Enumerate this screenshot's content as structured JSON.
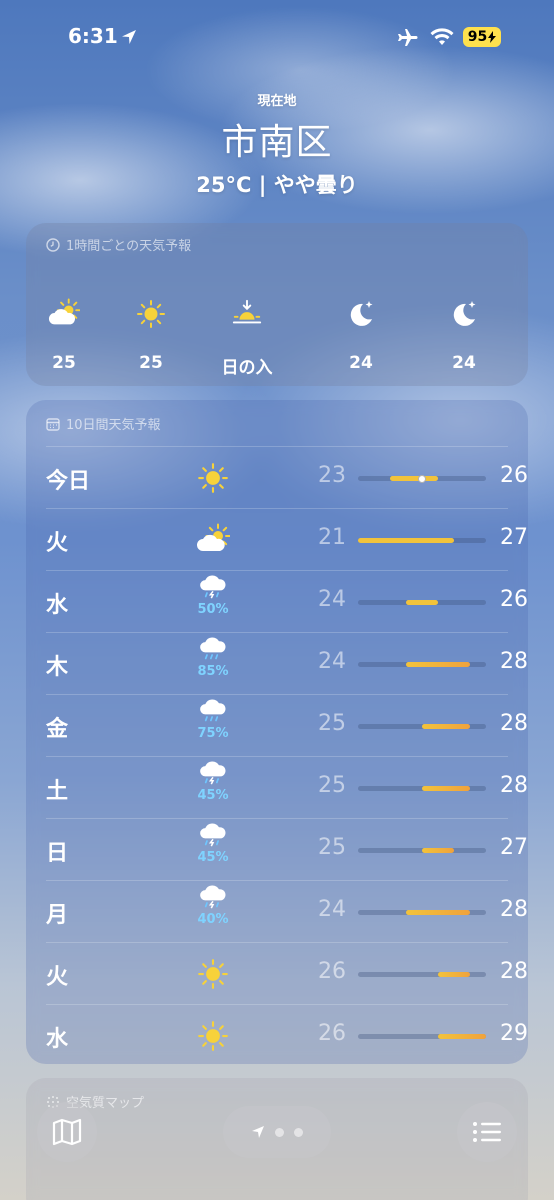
{
  "status": {
    "time": "6:31",
    "battery": "95"
  },
  "header": {
    "current_label": "現在地",
    "city": "市南区",
    "condition": "25°C | やや曇り"
  },
  "hourly": {
    "title": "1時間ごとの天気予報",
    "items": [
      {
        "icon": "partly-cloudy-sun-icon",
        "value": "25"
      },
      {
        "icon": "sun-icon",
        "value": "25"
      },
      {
        "icon": "sunset-icon",
        "value": "日の入"
      },
      {
        "icon": "moon-stars-icon",
        "value": "24"
      },
      {
        "icon": "moon-stars-icon",
        "value": "24"
      }
    ]
  },
  "ten_day": {
    "title": "10日間天気予報",
    "range": [
      21,
      29
    ],
    "current_temp": 25,
    "days": [
      {
        "day": "今日",
        "icon": "sun-icon",
        "pct": "",
        "low": "23",
        "high": "26",
        "lo_v": 23,
        "hi_v": 26
      },
      {
        "day": "火",
        "icon": "partly-cloudy-sun-icon",
        "pct": "",
        "low": "21",
        "high": "27",
        "lo_v": 21,
        "hi_v": 27
      },
      {
        "day": "水",
        "icon": "thunderstorm-rain-icon",
        "pct": "50%",
        "low": "24",
        "high": "26",
        "lo_v": 24,
        "hi_v": 26
      },
      {
        "day": "木",
        "icon": "rain-cloud-icon",
        "pct": "85%",
        "low": "24",
        "high": "28",
        "lo_v": 24,
        "hi_v": 28
      },
      {
        "day": "金",
        "icon": "rain-cloud-icon",
        "pct": "75%",
        "low": "25",
        "high": "28",
        "lo_v": 25,
        "hi_v": 28
      },
      {
        "day": "土",
        "icon": "thunderstorm-rain-icon",
        "pct": "45%",
        "low": "25",
        "high": "28",
        "lo_v": 25,
        "hi_v": 28
      },
      {
        "day": "日",
        "icon": "thunderstorm-rain-icon",
        "pct": "45%",
        "low": "25",
        "high": "27",
        "lo_v": 25,
        "hi_v": 27
      },
      {
        "day": "月",
        "icon": "thunderstorm-rain-icon",
        "pct": "40%",
        "low": "24",
        "high": "28",
        "lo_v": 24,
        "hi_v": 28
      },
      {
        "day": "火",
        "icon": "sun-icon",
        "pct": "",
        "low": "26",
        "high": "28",
        "lo_v": 26,
        "hi_v": 28
      },
      {
        "day": "水",
        "icon": "sun-icon",
        "pct": "",
        "low": "26",
        "high": "29",
        "lo_v": 26,
        "hi_v": 29
      }
    ]
  },
  "air_quality": {
    "title": "空気質マップ"
  },
  "colors": {
    "bar_yellow": "#f2c33b",
    "bar_orange": "#f0a23c",
    "precip": "#7fd3ff",
    "battery": "#ffe14d"
  }
}
